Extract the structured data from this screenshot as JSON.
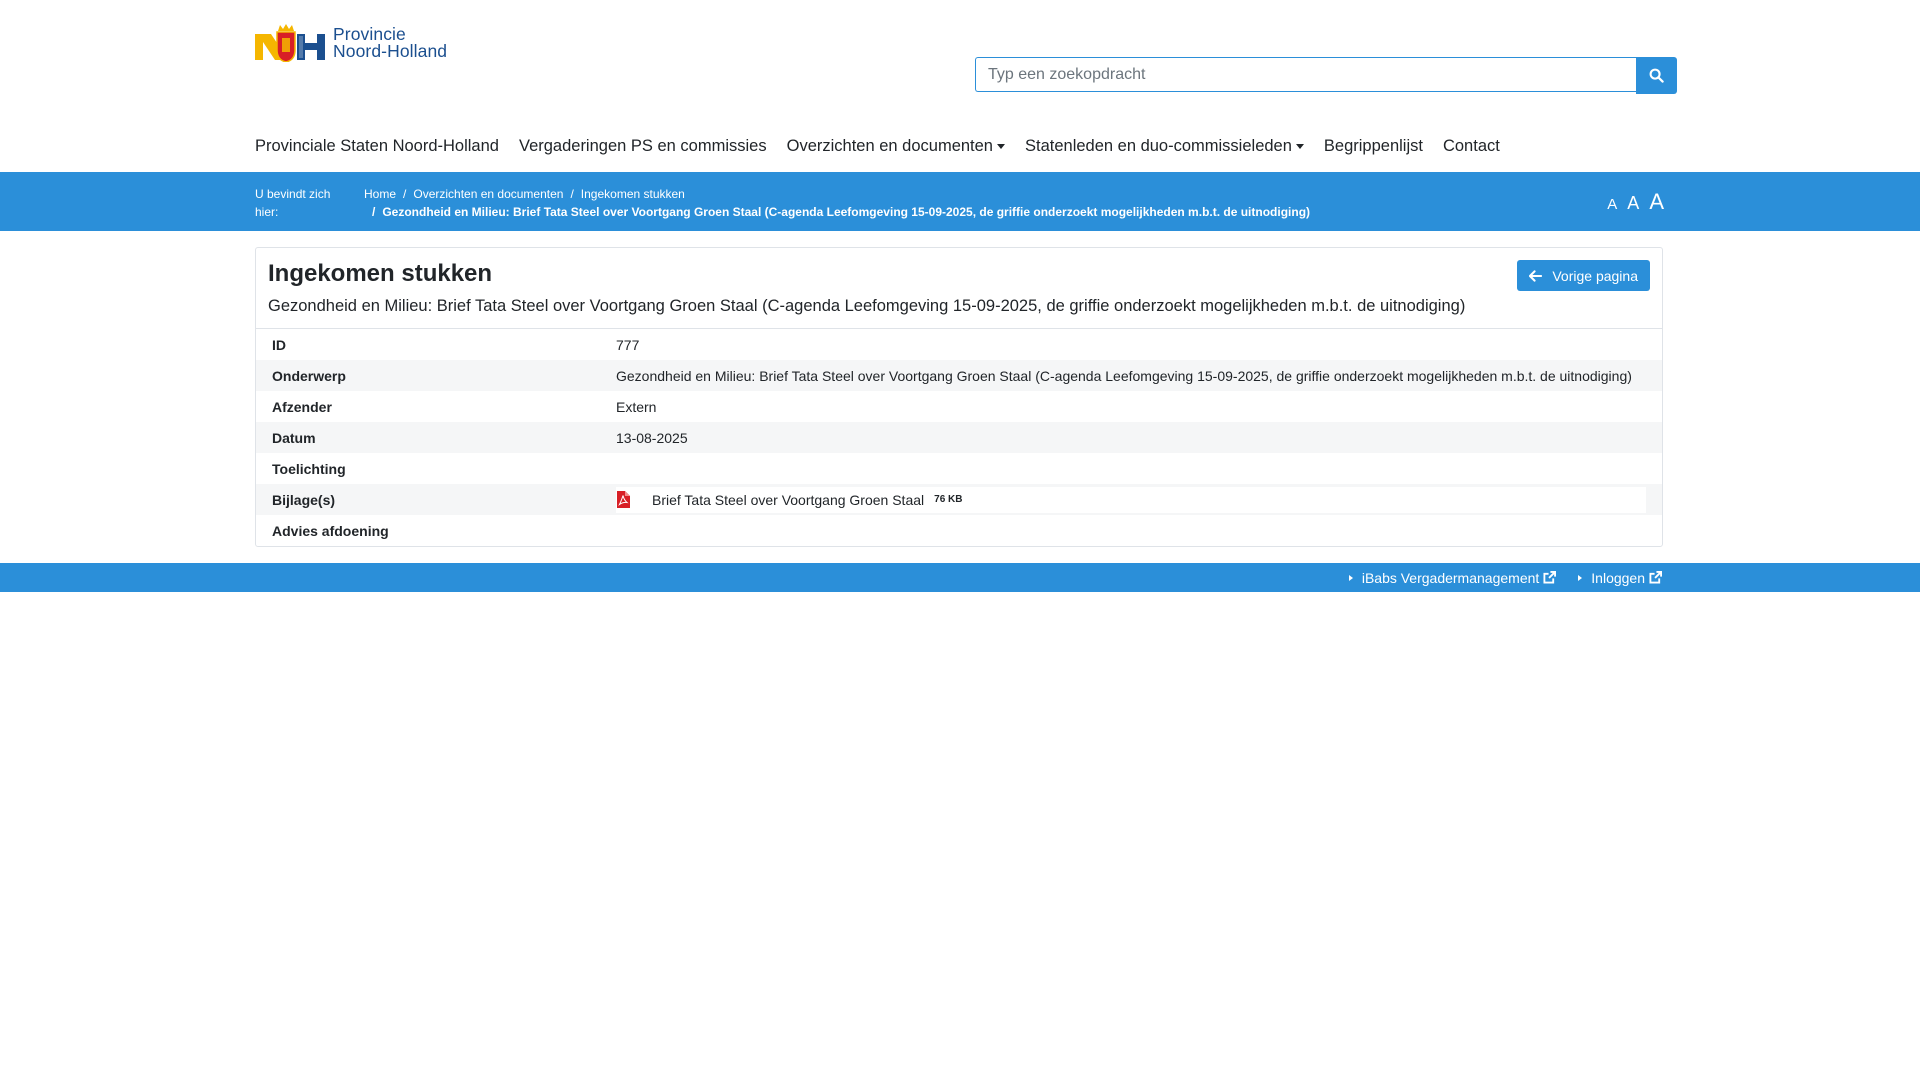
{
  "brand": {
    "logo_line1": "Provincie",
    "logo_line2": "Noord-Holland",
    "colors": {
      "primary": "#2b8fd9",
      "logo_text": "#1b4f8f",
      "logo_yellow": "#f5b600",
      "pdf_red": "#d81f26"
    }
  },
  "search": {
    "placeholder": "Typ een zoekopdracht",
    "icon": "search-icon"
  },
  "nav": {
    "items": [
      {
        "label": "Provinciale Staten Noord-Holland"
      },
      {
        "label": "Vergaderingen PS en commissies"
      },
      {
        "label": "Overzichten en documenten"
      },
      {
        "label": "Statenleden en duo-commissieleden"
      },
      {
        "label": "Begrippenlijst"
      },
      {
        "label": "Contact"
      }
    ]
  },
  "breadcrumb": {
    "label": "U bevindt zich hier:",
    "items": [
      "Home",
      "Overzichten en documenten",
      "Ingekomen stukken"
    ],
    "current": "Gezondheid en Milieu: Brief Tata Steel over Voortgang Groen Staal (C-agenda Leefomgeving 15-09-2025, de griffie onderzoekt mogelijkheden m.b.t. de uitnodiging)",
    "separator": "/"
  },
  "font_size_controls": {
    "small": "A",
    "medium": "A",
    "large": "A"
  },
  "detail": {
    "title": "Ingekomen stukken",
    "subtitle": "Gezondheid en Milieu: Brief Tata Steel over Voortgang Groen Staal (C-agenda Leefomgeving 15-09-2025, de griffie onderzoekt mogelijkheden m.b.t. de uitnodiging)",
    "back_button": "Vorige pagina",
    "rows": [
      {
        "key": "ID",
        "value": "777"
      },
      {
        "key": "Onderwerp",
        "value": "Gezondheid en Milieu: Brief Tata Steel over Voortgang Groen Staal (C-agenda Leefomgeving 15-09-2025, de griffie onderzoekt mogelijkheden m.b.t. de uitnodiging)"
      },
      {
        "key": "Afzender",
        "value": "Extern"
      },
      {
        "key": "Datum",
        "value": "13-08-2025"
      },
      {
        "key": "Toelichting",
        "value": ""
      },
      {
        "key": "Bijlage(s)",
        "value": ""
      },
      {
        "key": "Advies afdoening",
        "value": ""
      }
    ],
    "attachment": {
      "name": "Brief Tata Steel over Voortgang Groen Staal",
      "size": "76 KB",
      "icon": "pdf-icon"
    }
  },
  "footer": {
    "links": [
      {
        "label": "iBabs Vergadermanagement",
        "icon": "external-link-icon"
      },
      {
        "label": "Inloggen",
        "icon": "external-link-icon"
      }
    ]
  }
}
